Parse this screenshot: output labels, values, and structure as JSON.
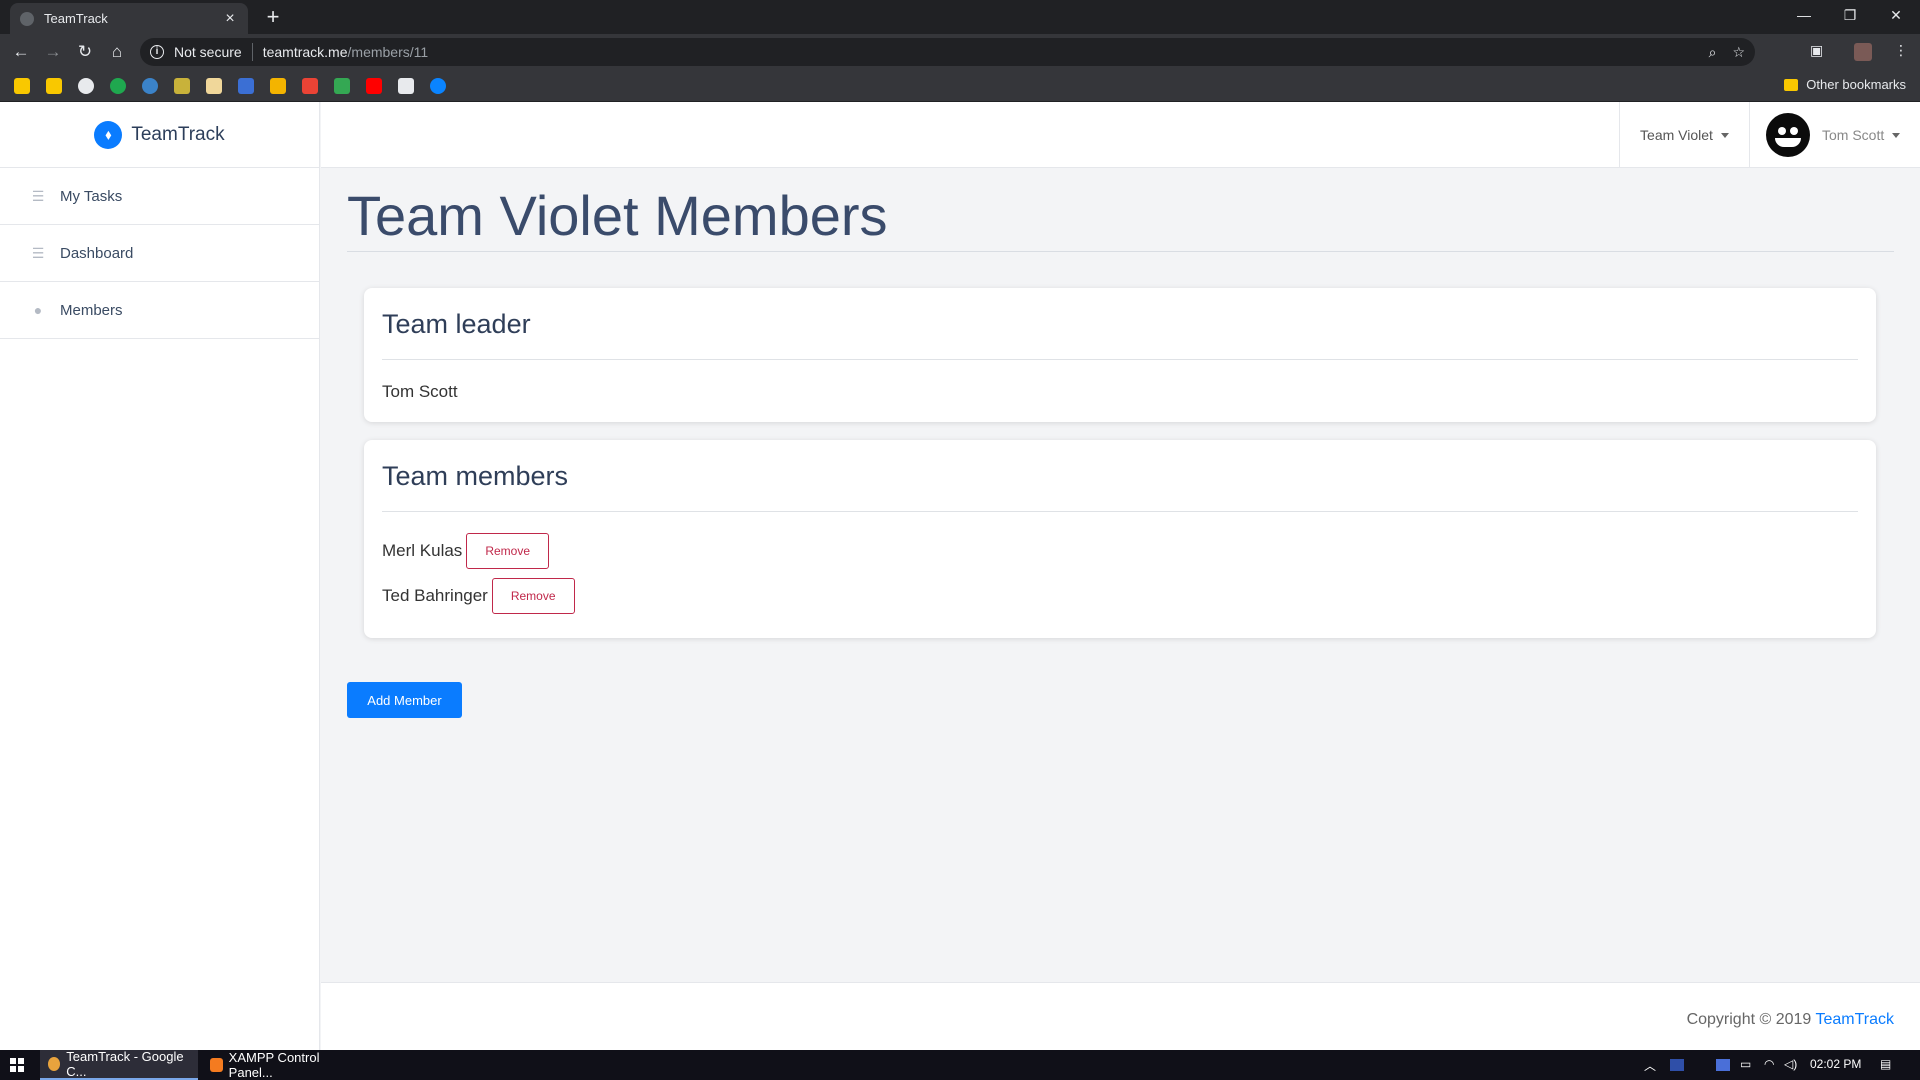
{
  "browser": {
    "tab_title": "TeamTrack",
    "tab_close": "×",
    "new_tab": "+",
    "security_label": "Not secure",
    "url_host": "teamtrack.me",
    "url_path": "/members/11",
    "other_bookmarks": "Other bookmarks"
  },
  "sidebar": {
    "brand": "TeamTrack",
    "items": [
      {
        "label": "My Tasks",
        "icon": "list-icon"
      },
      {
        "label": "Dashboard",
        "icon": "list-icon"
      },
      {
        "label": "Members",
        "icon": "user-icon"
      }
    ]
  },
  "topbar": {
    "team_selector": "Team Violet",
    "user_name": "Tom Scott"
  },
  "page": {
    "title": "Team Violet Members",
    "leader_card": {
      "heading": "Team leader",
      "name": "Tom Scott"
    },
    "members_card": {
      "heading": "Team members",
      "members": [
        {
          "name": "Merl Kulas",
          "action": "Remove"
        },
        {
          "name": "Ted Bahringer",
          "action": "Remove"
        }
      ]
    },
    "add_button": "Add Member"
  },
  "footer": {
    "copyright": "Copyright © 2019",
    "brand": "TeamTrack"
  },
  "taskbar": {
    "apps": [
      {
        "label": "TeamTrack - Google C..."
      },
      {
        "label": "XAMPP Control Panel..."
      }
    ],
    "time": "02:02 PM"
  },
  "colors": {
    "accent": "#0a7cff",
    "danger": "#c0284a",
    "heading": "#3a4b6b"
  }
}
